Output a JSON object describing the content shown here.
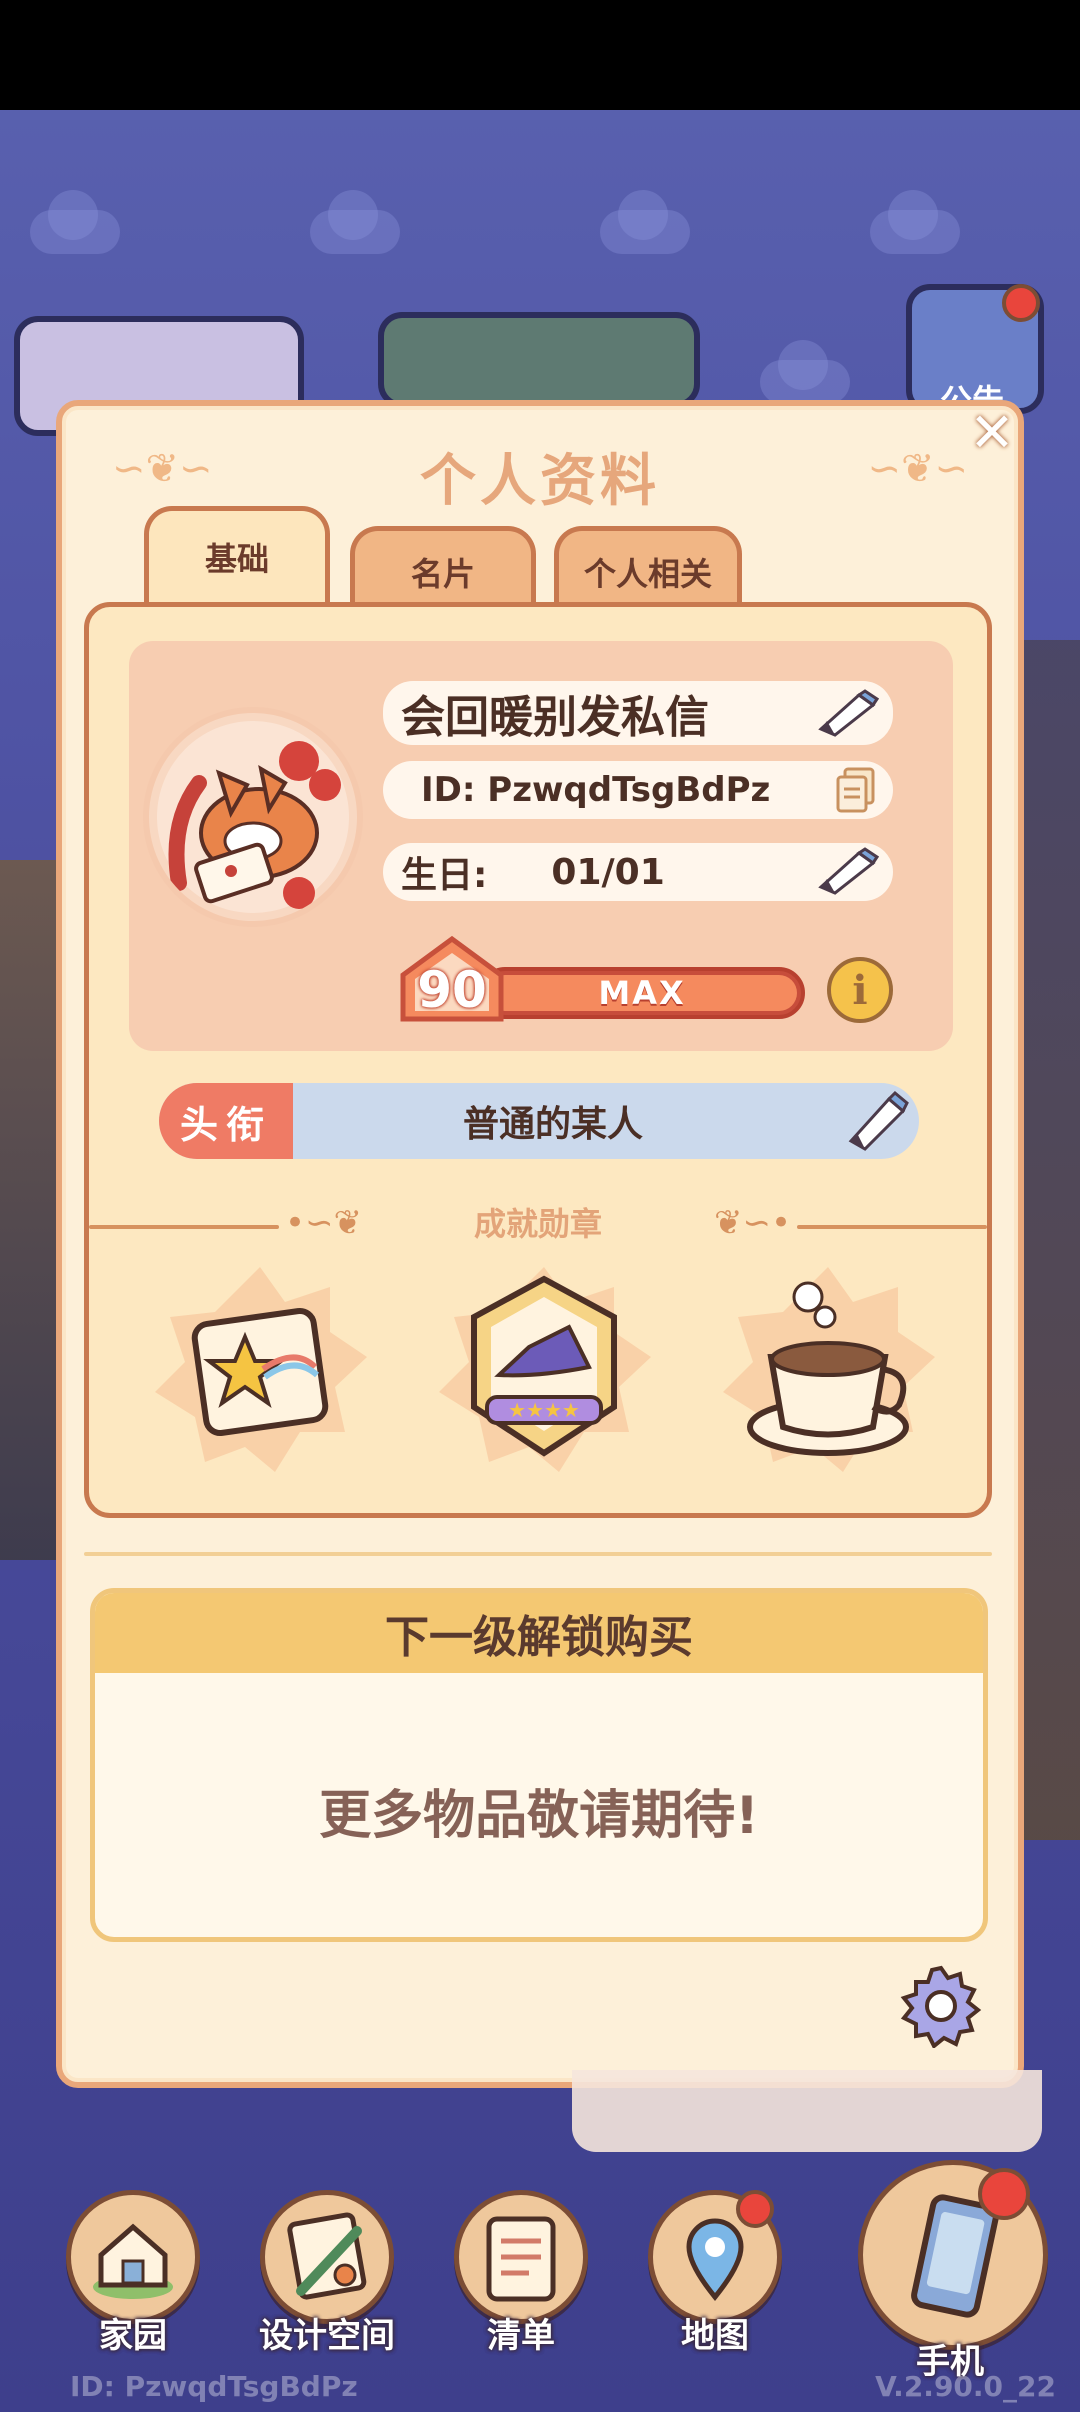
{
  "panel": {
    "title": "个人资料",
    "close_icon": "close-icon"
  },
  "tabs": [
    {
      "label": "基础",
      "active": true
    },
    {
      "label": "名片",
      "active": false
    },
    {
      "label": "个人相关",
      "active": false
    }
  ],
  "profile": {
    "nickname": "会回暖别发私信",
    "id_text": "ID: PzwqdTsgBdPz",
    "birthday_label": "生日:",
    "birthday_value": "01/01",
    "level": "90",
    "level_bar_label": "MAX",
    "level_progress": 1.0,
    "info_glyph": "i"
  },
  "title_row": {
    "tag": "头衔",
    "value": "普通的某人"
  },
  "achievements": {
    "section_label": "成就勋章",
    "badges": [
      "star-map-badge",
      "witch-hat-badge",
      "coffee-cup-badge"
    ]
  },
  "unlock": {
    "header": "下一级解锁购买",
    "message": "更多物品敬请期待!"
  },
  "bottom_nav": [
    {
      "label": "家园",
      "icon": "home-icon",
      "notification": false
    },
    {
      "label": "设计空间",
      "icon": "design-icon",
      "notification": false
    },
    {
      "label": "清单",
      "icon": "list-icon",
      "notification": false
    },
    {
      "label": "地图",
      "icon": "map-pin-icon",
      "notification": true
    },
    {
      "label": "手机",
      "icon": "phone-icon",
      "notification": true
    }
  ],
  "top_right_label": "公告",
  "footer": {
    "id": "ID: PzwqdTsgBdPz",
    "version": "V.2.90.0_22"
  },
  "colors": {
    "panel_bg": "#fdf0d9",
    "panel_border": "#e9a77a",
    "accent_red": "#ef7b65",
    "title_blue": "#cbd9ec"
  }
}
